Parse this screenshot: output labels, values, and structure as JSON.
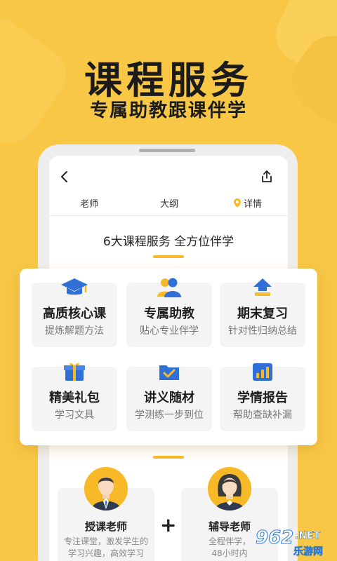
{
  "hero": {
    "title": "课程服务",
    "subtitle": "专属助教跟课伴学"
  },
  "nav": {
    "back_icon": "chevron-left-icon",
    "share_icon": "share-icon"
  },
  "tabs": [
    {
      "label": "老师"
    },
    {
      "label": "大纲"
    },
    {
      "label": "详情",
      "icon": "location-pin-icon"
    }
  ],
  "section": {
    "title": "6大课程服务  全方位伴学"
  },
  "services": [
    {
      "title": "高质核心课",
      "desc": "提炼解题方法",
      "icon": "graduation-cap-icon"
    },
    {
      "title": "专属助教",
      "desc": "贴心专业伴学",
      "icon": "people-icon"
    },
    {
      "title": "期末复习",
      "desc": "针对性归纳总结",
      "icon": "stack-up-icon"
    },
    {
      "title": "精美礼包",
      "desc": "学习文具",
      "icon": "gift-icon"
    },
    {
      "title": "讲义随材",
      "desc": "学测练一步到位",
      "icon": "folder-check-icon"
    },
    {
      "title": "学情报告",
      "desc": "帮助查缺补漏",
      "icon": "bar-chart-icon"
    }
  ],
  "teachers": [
    {
      "name": "授课老师",
      "desc_line1": "专注课堂，激发学生的",
      "desc_line2": "学习兴趣，高效学习"
    },
    {
      "name": "辅导老师",
      "desc_line1": "全程伴学，",
      "desc_line2": "48小时内"
    }
  ],
  "plus_sign": "+",
  "watermark": {
    "num": "962",
    "net": ".NET",
    "sub": "乐游网"
  },
  "colors": {
    "background": "#f8c746",
    "accent": "#f7b928",
    "icon_blue": "#2f6fd6"
  }
}
